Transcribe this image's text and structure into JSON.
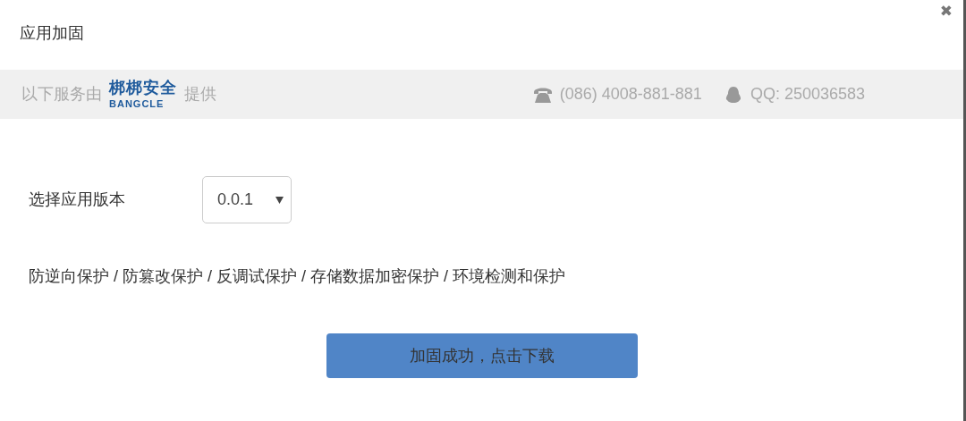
{
  "dialog": {
    "title": "应用加固",
    "close": "✖"
  },
  "provider_bar": {
    "prefix": "以下服务由",
    "logo_name": "梆梆安全",
    "logo_sub": "BANGCLE",
    "suffix": "提供",
    "phone": "(086) 4008-881-881",
    "qq": "QQ: 250036583"
  },
  "version": {
    "label": "选择应用版本",
    "value": "0.0.1"
  },
  "features": "防逆向保护 / 防篡改保护 / 反调试保护 / 存储数据加密保护 / 环境检测和保护",
  "download_button": "加固成功，点击下载"
}
